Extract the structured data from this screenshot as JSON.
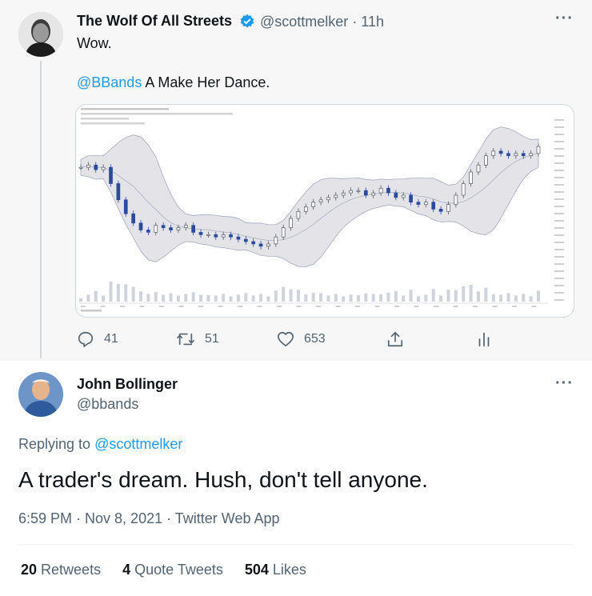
{
  "parent_tweet": {
    "display_name": "The Wolf Of All Streets",
    "handle": "@scottmelker",
    "time": "· 11h",
    "text_line1": "Wow.",
    "mention": "@BBands",
    "text_line2": " A Make Her Dance.",
    "actions": {
      "reply_count": "41",
      "retweet_count": "51",
      "like_count": "653"
    }
  },
  "reply_tweet": {
    "display_name": "John Bollinger",
    "handle": "@bbands",
    "replying_prefix": "Replying to ",
    "replying_handle": "@scottmelker",
    "text": "A trader's dream. Hush, don't tell anyone.",
    "meta": "6:59 PM · Nov 8, 2021 · Twitter Web App",
    "stats": {
      "retweets_count": "20",
      "retweets_label": " Retweets",
      "quotes_count": "4",
      "quotes_label": " Quote Tweets",
      "likes_count": "504",
      "likes_label": " Likes"
    }
  },
  "colors": {
    "link": "#1d9bf0",
    "verified": "#1d9bf0",
    "muted": "#536471"
  },
  "chart_data": {
    "type": "line",
    "series": [
      {
        "values": [
          62,
          63,
          61,
          62,
          55,
          48,
          42,
          38,
          35,
          34,
          37,
          36,
          35,
          36,
          37,
          34,
          33,
          33,
          32,
          33,
          32,
          31,
          30,
          29,
          28,
          29,
          32,
          36,
          40,
          43,
          45,
          47,
          48,
          49,
          50,
          51,
          52,
          52,
          50,
          51,
          53,
          51,
          49,
          50,
          47,
          46,
          47,
          44,
          43,
          46,
          50,
          55,
          60,
          63,
          67,
          69,
          68,
          67,
          68,
          67,
          68,
          71
        ]
      }
    ],
    "grid": false
  }
}
